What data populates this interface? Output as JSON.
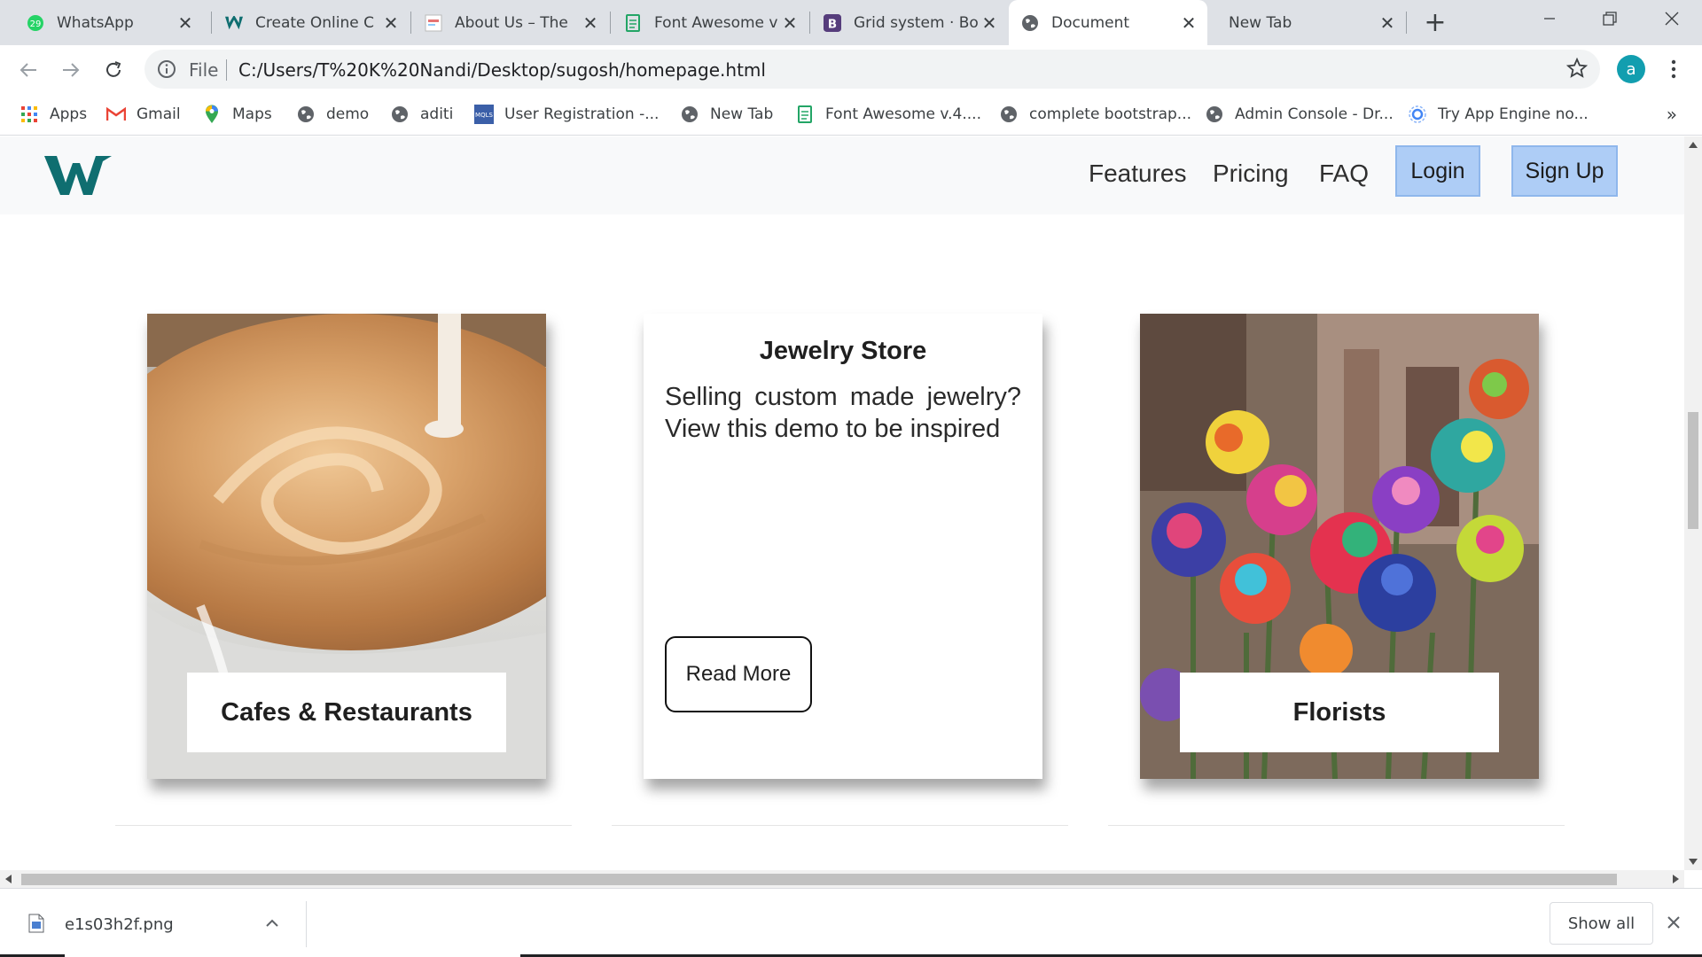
{
  "browser": {
    "tabs": [
      {
        "title": "WhatsApp",
        "icon": "whatsapp-icon",
        "badge": "29"
      },
      {
        "title": "Create Online C",
        "icon": "w-icon"
      },
      {
        "title": "About Us – The",
        "icon": "site-icon"
      },
      {
        "title": "Font Awesome v",
        "icon": "doc-icon"
      },
      {
        "title": "Grid system · Bo",
        "icon": "bootstrap-icon"
      },
      {
        "title": "Document",
        "icon": "globe-icon",
        "active": true
      },
      {
        "title": "New Tab",
        "icon": "none"
      }
    ],
    "address": {
      "scheme_label": "File",
      "url": "C:/Users/T%20K%20Nandi/Desktop/sugosh/homepage.html"
    },
    "profile_initial": "a",
    "bookmarks": [
      {
        "label": "Apps",
        "icon": "apps-grid-icon"
      },
      {
        "label": "Gmail",
        "icon": "gmail-icon"
      },
      {
        "label": "Maps",
        "icon": "maps-icon"
      },
      {
        "label": "demo",
        "icon": "globe-icon"
      },
      {
        "label": "aditi",
        "icon": "globe-icon"
      },
      {
        "label": "User Registration -...",
        "icon": "mqls-icon"
      },
      {
        "label": "New Tab",
        "icon": "globe-icon"
      },
      {
        "label": "Font Awesome v.4....",
        "icon": "doc-icon"
      },
      {
        "label": "complete bootstrap...",
        "icon": "globe-icon"
      },
      {
        "label": "Admin Console - Dr...",
        "icon": "globe-icon"
      },
      {
        "label": "Try App Engine no...",
        "icon": "app-engine-icon"
      }
    ],
    "bookmarks_overflow": "»"
  },
  "site": {
    "nav": {
      "links": [
        "Features",
        "Pricing",
        "FAQ"
      ],
      "login_label": "Login",
      "signup_label": "Sign Up"
    },
    "cards": [
      {
        "label": "Cafes & Restaurants",
        "image": "coffee-latte-image"
      },
      {
        "title": "Jewelry Store",
        "description": "Selling custom made jewelry? View this demo to be inspired",
        "button": "Read More"
      },
      {
        "label": "Florists",
        "image": "rainbow-roses-image"
      }
    ]
  },
  "download_bar": {
    "file_name": "e1s03h2f.png",
    "show_all_label": "Show all"
  },
  "colors": {
    "brand_teal": "#0f6e70",
    "nav_button_bg": "#aecdf6",
    "tabstrip_bg": "#dee1e6"
  }
}
